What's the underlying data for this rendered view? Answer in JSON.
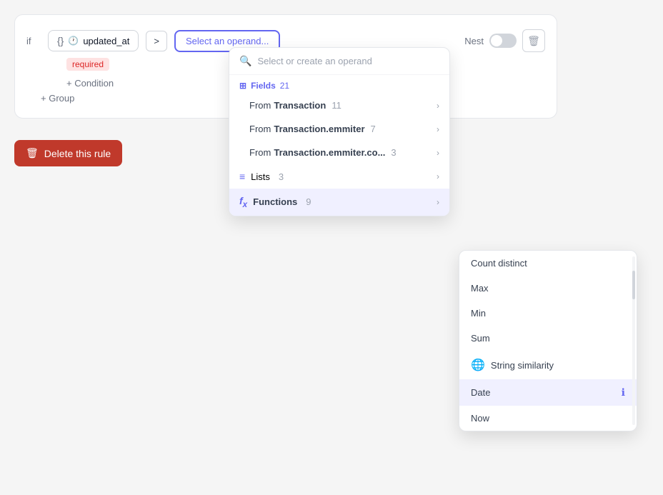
{
  "rule": {
    "if_label": "if",
    "field_icon_obj": "{}",
    "field_icon_clock": "⏱",
    "field_name": "updated_at",
    "operator": ">",
    "operand_placeholder": "Select an operand...",
    "nest_label": "Nest",
    "required_badge": "required",
    "add_condition_label": "+ Condition",
    "add_group_label": "+ Group",
    "delete_label": "Delete this rule"
  },
  "dropdown": {
    "search_placeholder": "Select or create an operand",
    "fields_label": "Fields",
    "fields_count": "21",
    "from_transaction_label": "From ",
    "from_transaction_bold": "Transaction",
    "from_transaction_count": "11",
    "from_emmiter_label": "From ",
    "from_emmiter_bold": "Transaction.emmiter",
    "from_emmiter_count": "7",
    "from_co_label": "From ",
    "from_co_bold": "Transaction.emmiter.co...",
    "from_co_count": "3",
    "lists_label": "Lists",
    "lists_count": "3",
    "functions_label": "Functions",
    "functions_count": "9"
  },
  "submenu": {
    "items": [
      {
        "label": "Count distinct",
        "icon": null,
        "active": false
      },
      {
        "label": "Max",
        "icon": null,
        "active": false
      },
      {
        "label": "Min",
        "icon": null,
        "active": false
      },
      {
        "label": "Sum",
        "icon": null,
        "active": false
      },
      {
        "label": "String similarity",
        "icon": "🌐",
        "active": false
      },
      {
        "label": "Date",
        "icon": null,
        "active": true
      },
      {
        "label": "Now",
        "icon": null,
        "active": false
      }
    ]
  },
  "icons": {
    "search": "🔍",
    "fields": "⊞",
    "chevron_right": "›",
    "lists": "≡",
    "functions": "fx",
    "trash": "🗑",
    "info": "ℹ"
  }
}
